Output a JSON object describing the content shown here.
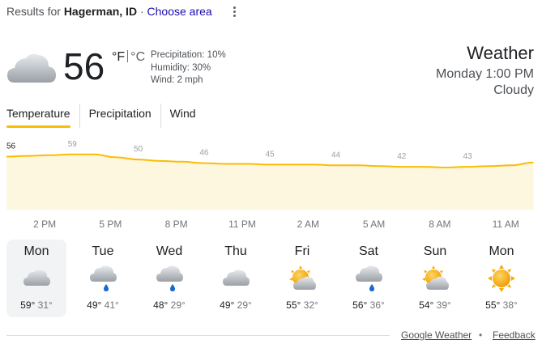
{
  "header": {
    "results_prefix": "Results for",
    "location": "Hagerman, ID",
    "separator": "·",
    "choose_area": "Choose area",
    "more_options_icon": "more-vert-icon"
  },
  "current": {
    "icon": "cloudy-icon",
    "temperature": "56",
    "unit_f": "°F",
    "unit_c": "°C",
    "precipitation": "Precipitation: 10%",
    "humidity": "Humidity: 30%",
    "wind": "Wind: 2 mph"
  },
  "summary": {
    "title": "Weather",
    "datetime": "Monday 1:00 PM",
    "condition": "Cloudy"
  },
  "tabs": [
    {
      "label": "Temperature",
      "active": true
    },
    {
      "label": "Precipitation",
      "active": false
    },
    {
      "label": "Wind",
      "active": false
    }
  ],
  "chart_data": {
    "type": "area",
    "x": [
      "1PM",
      "2PM",
      "3PM",
      "4PM",
      "5PM",
      "6PM",
      "7PM",
      "8PM",
      "9PM",
      "10PM",
      "11PM",
      "12AM",
      "1AM",
      "2AM",
      "3AM",
      "4AM",
      "5AM",
      "6AM",
      "7AM",
      "8AM",
      "9AM",
      "10AM",
      "11AM",
      "12PM",
      "1PM"
    ],
    "values": [
      56,
      57,
      58,
      59,
      59,
      55,
      52,
      50,
      49,
      47,
      46,
      46,
      45,
      45,
      45,
      44,
      44,
      43,
      42,
      42,
      41,
      42,
      43,
      44,
      48
    ],
    "labels": [
      {
        "index": 0,
        "text": "56"
      },
      {
        "index": 3,
        "text": "59"
      },
      {
        "index": 6,
        "text": "50"
      },
      {
        "index": 9,
        "text": "46"
      },
      {
        "index": 12,
        "text": "45"
      },
      {
        "index": 15,
        "text": "44"
      },
      {
        "index": 18,
        "text": "42"
      },
      {
        "index": 21,
        "text": "43"
      }
    ],
    "tick_labels": [
      "2 PM",
      "5 PM",
      "8 PM",
      "11 PM",
      "2 AM",
      "5 AM",
      "8 AM",
      "11 AM"
    ],
    "tick_indices": [
      1,
      4,
      7,
      10,
      13,
      16,
      19,
      22
    ],
    "line_color": "#fbbc04",
    "fill_color": "#fef7e0",
    "grid": false
  },
  "days": [
    {
      "name": "Mon",
      "icon": "cloudy-icon",
      "hi": "59°",
      "lo": "31°",
      "selected": true
    },
    {
      "name": "Tue",
      "icon": "showers-icon",
      "hi": "49°",
      "lo": "41°",
      "selected": false
    },
    {
      "name": "Wed",
      "icon": "showers-icon",
      "hi": "48°",
      "lo": "29°",
      "selected": false
    },
    {
      "name": "Thu",
      "icon": "cloudy-icon",
      "hi": "49°",
      "lo": "29°",
      "selected": false
    },
    {
      "name": "Fri",
      "icon": "partly-cloudy-icon",
      "hi": "55°",
      "lo": "32°",
      "selected": false
    },
    {
      "name": "Sat",
      "icon": "showers-icon",
      "hi": "56°",
      "lo": "36°",
      "selected": false
    },
    {
      "name": "Sun",
      "icon": "partly-cloudy-icon",
      "hi": "54°",
      "lo": "39°",
      "selected": false
    },
    {
      "name": "Mon",
      "icon": "sunny-icon",
      "hi": "55°",
      "lo": "38°",
      "selected": false
    }
  ],
  "footer": {
    "source": "Google Weather",
    "separator": "•",
    "feedback": "Feedback"
  },
  "colors": {
    "accent": "#fbbc04",
    "link": "#1a0dab",
    "text_secondary": "#70757a"
  }
}
